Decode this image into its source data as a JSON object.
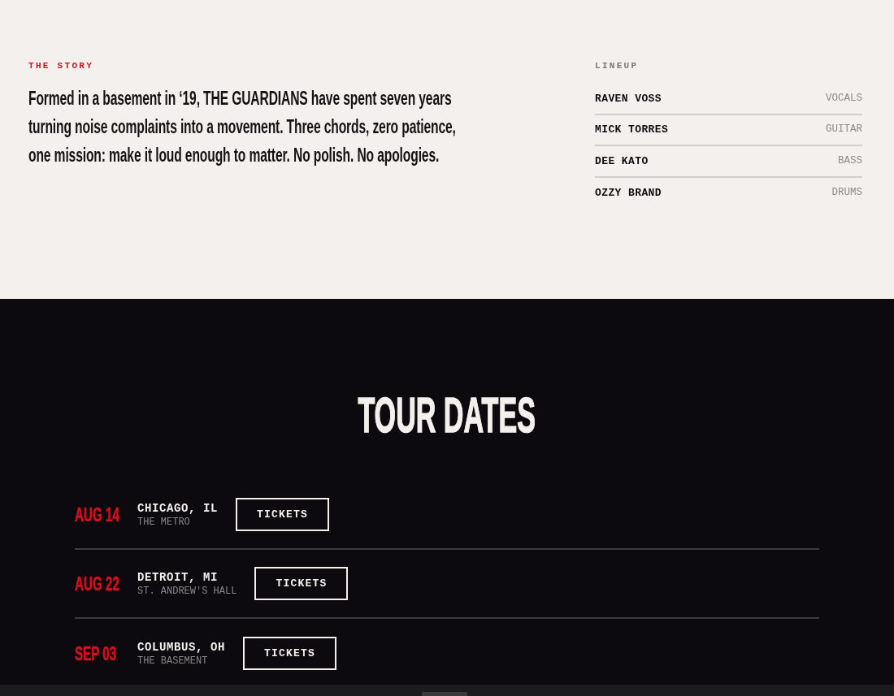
{
  "story": {
    "label": "THE STORY",
    "text": "Formed in a basement in ‘19, THE GUARDIANS have spent seven years turning noise complaints into a movement. Three chords, zero patience, one mission: make it loud enough to matter. No polish. No apologies."
  },
  "lineup": {
    "label": "LINEUP",
    "members": [
      {
        "name": "RAVEN VOSS",
        "role": "VOCALS"
      },
      {
        "name": "MICK TORRES",
        "role": "GUITAR"
      },
      {
        "name": "DEE KATO",
        "role": "BASS"
      },
      {
        "name": "OZZY BRAND",
        "role": "DRUMS"
      }
    ]
  },
  "tour": {
    "title": "TOUR DATES",
    "dates": [
      {
        "date": "AUG 14",
        "city": "CHICAGO, IL",
        "venue": "THE METRO",
        "button": "TICKETS"
      },
      {
        "date": "AUG 22",
        "city": "DETROIT, MI",
        "venue": "ST. ANDREW'S HALL",
        "button": "TICKETS"
      },
      {
        "date": "SEP 03",
        "city": "COLUMBUS, OH",
        "venue": "THE BASEMENT",
        "button": "TICKETS"
      }
    ]
  }
}
